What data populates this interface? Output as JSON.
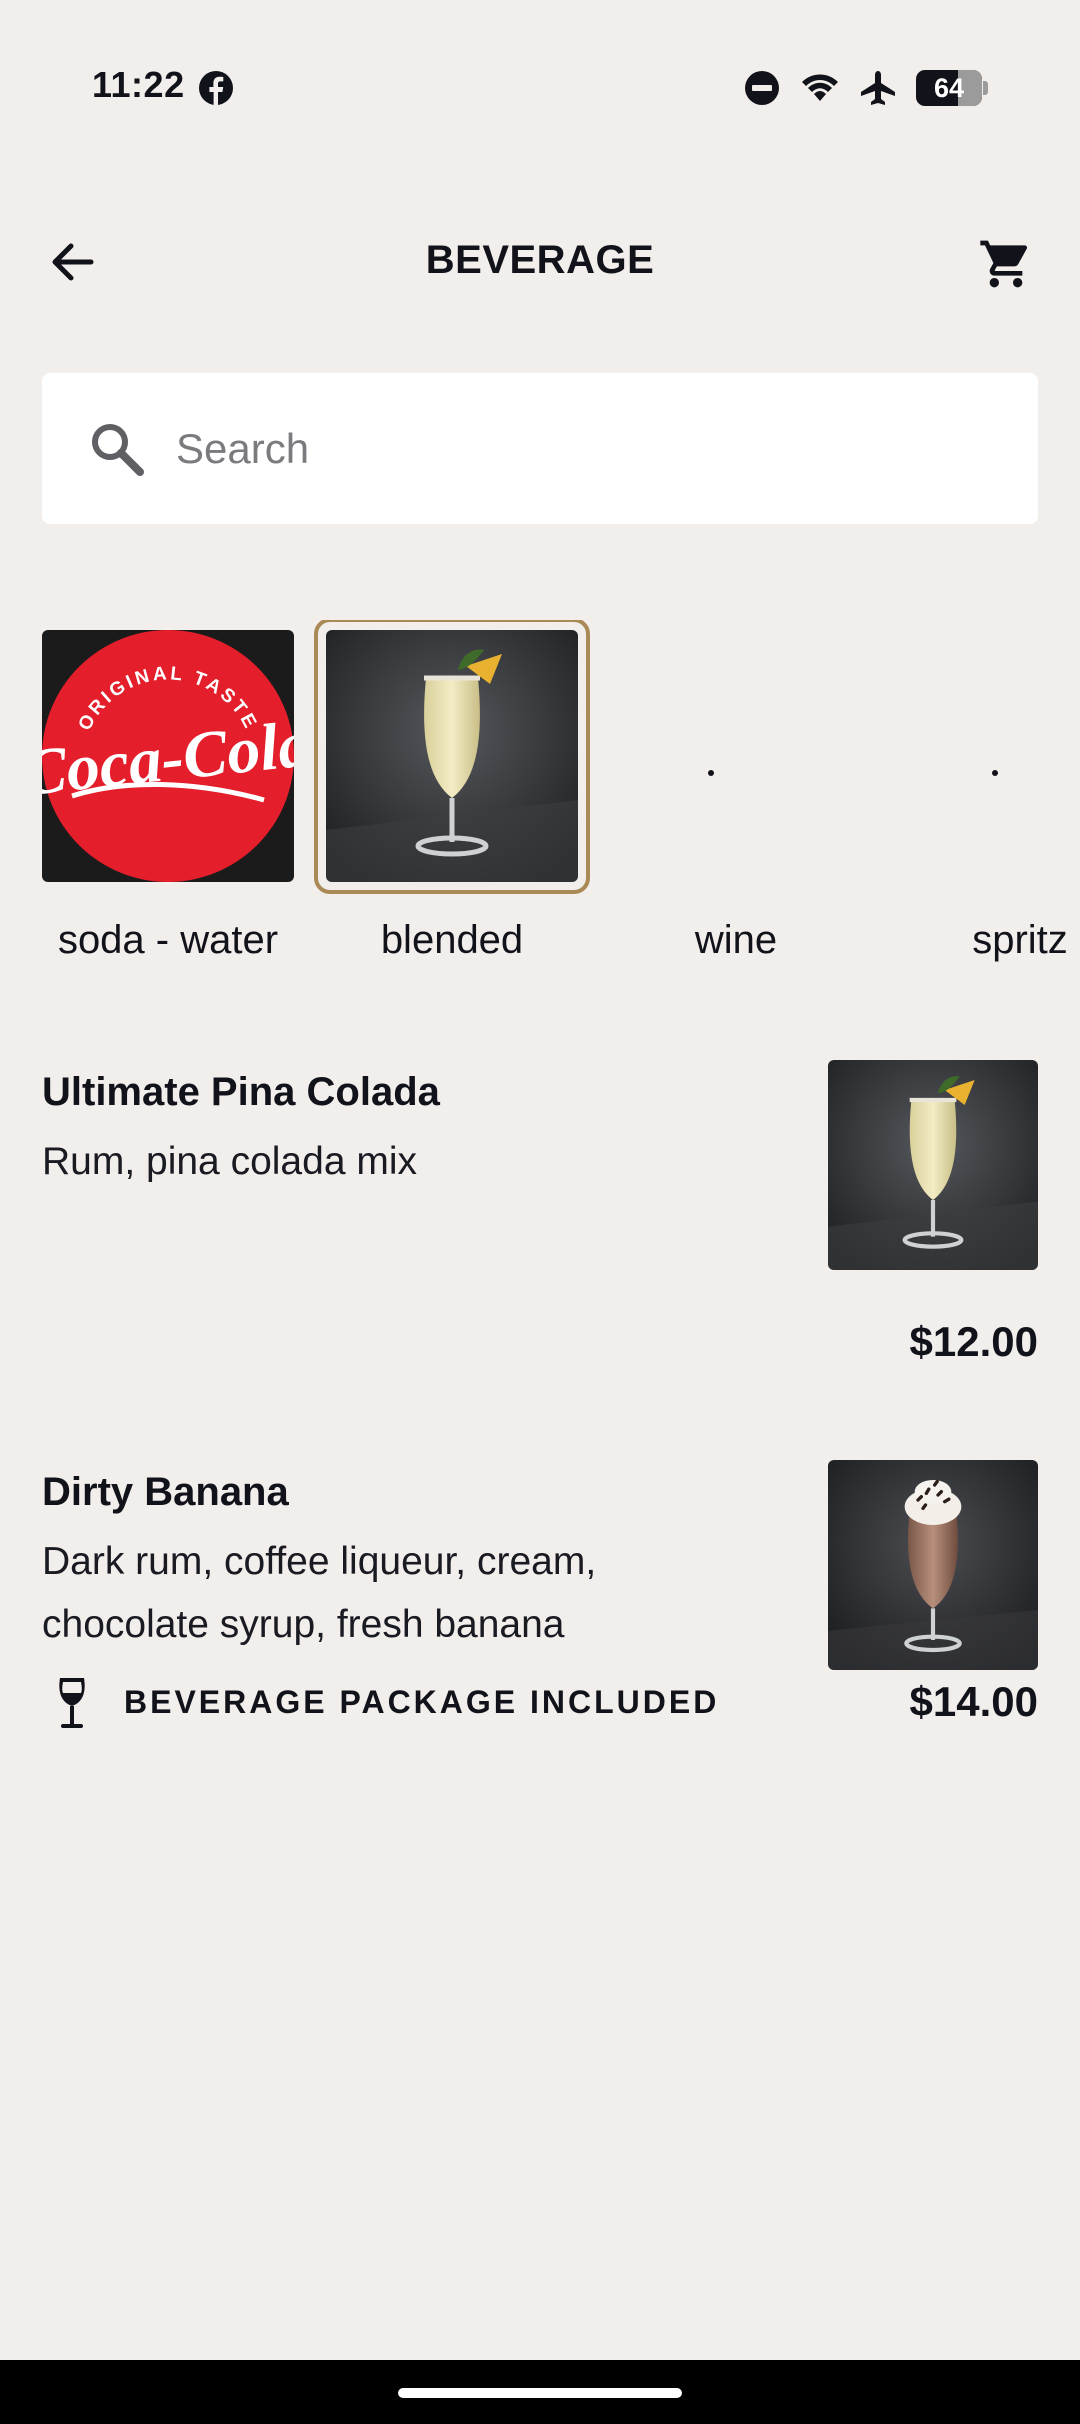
{
  "status_bar": {
    "time": "11:22",
    "battery": "64",
    "battery_level_percent": 64,
    "icons": [
      "facebook-icon",
      "do-not-disturb-icon",
      "wifi-icon",
      "airplane-icon",
      "battery-icon"
    ]
  },
  "header": {
    "title": "BEVERAGE",
    "back_icon": "arrow-left-icon",
    "cart_icon": "cart-icon"
  },
  "search": {
    "placeholder": "Search",
    "value": "",
    "icon": "search-icon"
  },
  "categories": [
    {
      "label": "soda - water",
      "image": "coca-cola-logo",
      "selected": false
    },
    {
      "label": "blended",
      "image": "pina-colada-glass",
      "selected": true
    },
    {
      "label": "wine",
      "image": "none",
      "selected": false
    },
    {
      "label": "spritz",
      "image": "none",
      "selected": false
    }
  ],
  "items": [
    {
      "name": "Ultimate Pina Colada",
      "description": "Rum, pina colada mix",
      "price": "$12.00",
      "image": "pina-colada-glass",
      "package_included": false
    },
    {
      "name": "Dirty Banana",
      "description": "Dark rum, coffee liqueur, cream, chocolate syrup, fresh banana",
      "price": "$14.00",
      "image": "dirty-banana-glass",
      "package_included": true,
      "package_label": "BEVERAGE PACKAGE INCLUDED",
      "package_icon": "wine-glass-icon"
    }
  ],
  "colors": {
    "background": "#f1eeeb",
    "text": "#12121a",
    "selected_border": "#a98a55",
    "coca_cola_red": "#e41e2b"
  }
}
